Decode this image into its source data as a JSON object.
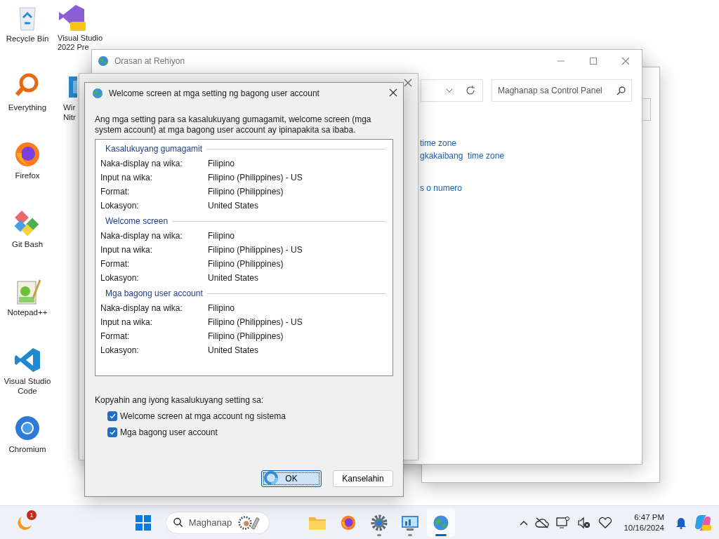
{
  "desktop_icons": [
    {
      "kind": "recycle",
      "label": "Recycle Bin"
    },
    {
      "kind": "everything",
      "label": "Everything"
    },
    {
      "kind": "firefox",
      "label": "Firefox"
    },
    {
      "kind": "gitbash",
      "label": "Git Bash"
    },
    {
      "kind": "notepad",
      "label": "Notepad++"
    },
    {
      "kind": "vscode",
      "label": "Visual Studio Code"
    },
    {
      "kind": "chromium",
      "label": "Chromium"
    },
    {
      "kind": "vs",
      "label": "Visual Studio 2022 Pre"
    },
    {
      "kind": "box",
      "label": "Wir Nitr"
    }
  ],
  "control_panel_window": {
    "title": "Orasan at Rehiyon",
    "search": {
      "placeholder": "Maghanap sa Control Panel"
    },
    "links": [
      "time zone",
      "gkakaibang  time zone",
      "s o numero"
    ]
  },
  "dialog": {
    "title": "Welcome screen at mga setting ng bagong user account",
    "description": "Ang mga setting para sa kasalukuyang gumagamit, welcome screen (mga system account) at mga bagong user account ay ipinapakita sa ibaba.",
    "groups": [
      {
        "title": "Kasalukuyang gumagamit",
        "rows": [
          {
            "label": "Naka-display na wika:",
            "value": "Filipino"
          },
          {
            "label": "Input na wika:",
            "value": "Filipino (Philippines) - US"
          },
          {
            "label": "Format:",
            "value": "Filipino (Philippines)"
          },
          {
            "label": "Lokasyon:",
            "value": "United States"
          }
        ]
      },
      {
        "title": "Welcome screen",
        "rows": [
          {
            "label": "Naka-display na wika:",
            "value": "Filipino"
          },
          {
            "label": "Input na wika:",
            "value": "Filipino (Philippines) - US"
          },
          {
            "label": "Format:",
            "value": "Filipino (Philippines)"
          },
          {
            "label": "Lokasyon:",
            "value": "United States"
          }
        ]
      },
      {
        "title": "Mga bagong user account",
        "rows": [
          {
            "label": "Naka-display na wika:",
            "value": "Filipino"
          },
          {
            "label": "Input na wika:",
            "value": "Filipino (Philippines) - US"
          },
          {
            "label": "Format:",
            "value": "Filipino (Philippines)"
          },
          {
            "label": "Lokasyon:",
            "value": "United States"
          }
        ]
      }
    ],
    "copy_label": "Kopyahin ang iyong kasalukuyang setting sa:",
    "checkboxes": [
      {
        "label": "Welcome screen at mga account ng sistema",
        "checked": true
      },
      {
        "label": "Mga bagong user account",
        "checked": true
      }
    ],
    "buttons": [
      {
        "label": "OK",
        "selected": true
      },
      {
        "label": "Kanselahin",
        "selected": false
      }
    ]
  },
  "taskbar": {
    "widget_badge": "1",
    "search": {
      "placeholder": "Maghanap"
    },
    "apps": [
      {
        "kind": "explorer",
        "running": false,
        "selected": false
      },
      {
        "kind": "firefox",
        "running": false,
        "selected": false
      },
      {
        "kind": "settings",
        "running": true,
        "selected": false
      },
      {
        "kind": "controlpanel",
        "running": true,
        "selected": false
      },
      {
        "kind": "globe",
        "running": true,
        "selected": true
      }
    ],
    "time": "6:47 PM",
    "date": "10/16/2024"
  }
}
